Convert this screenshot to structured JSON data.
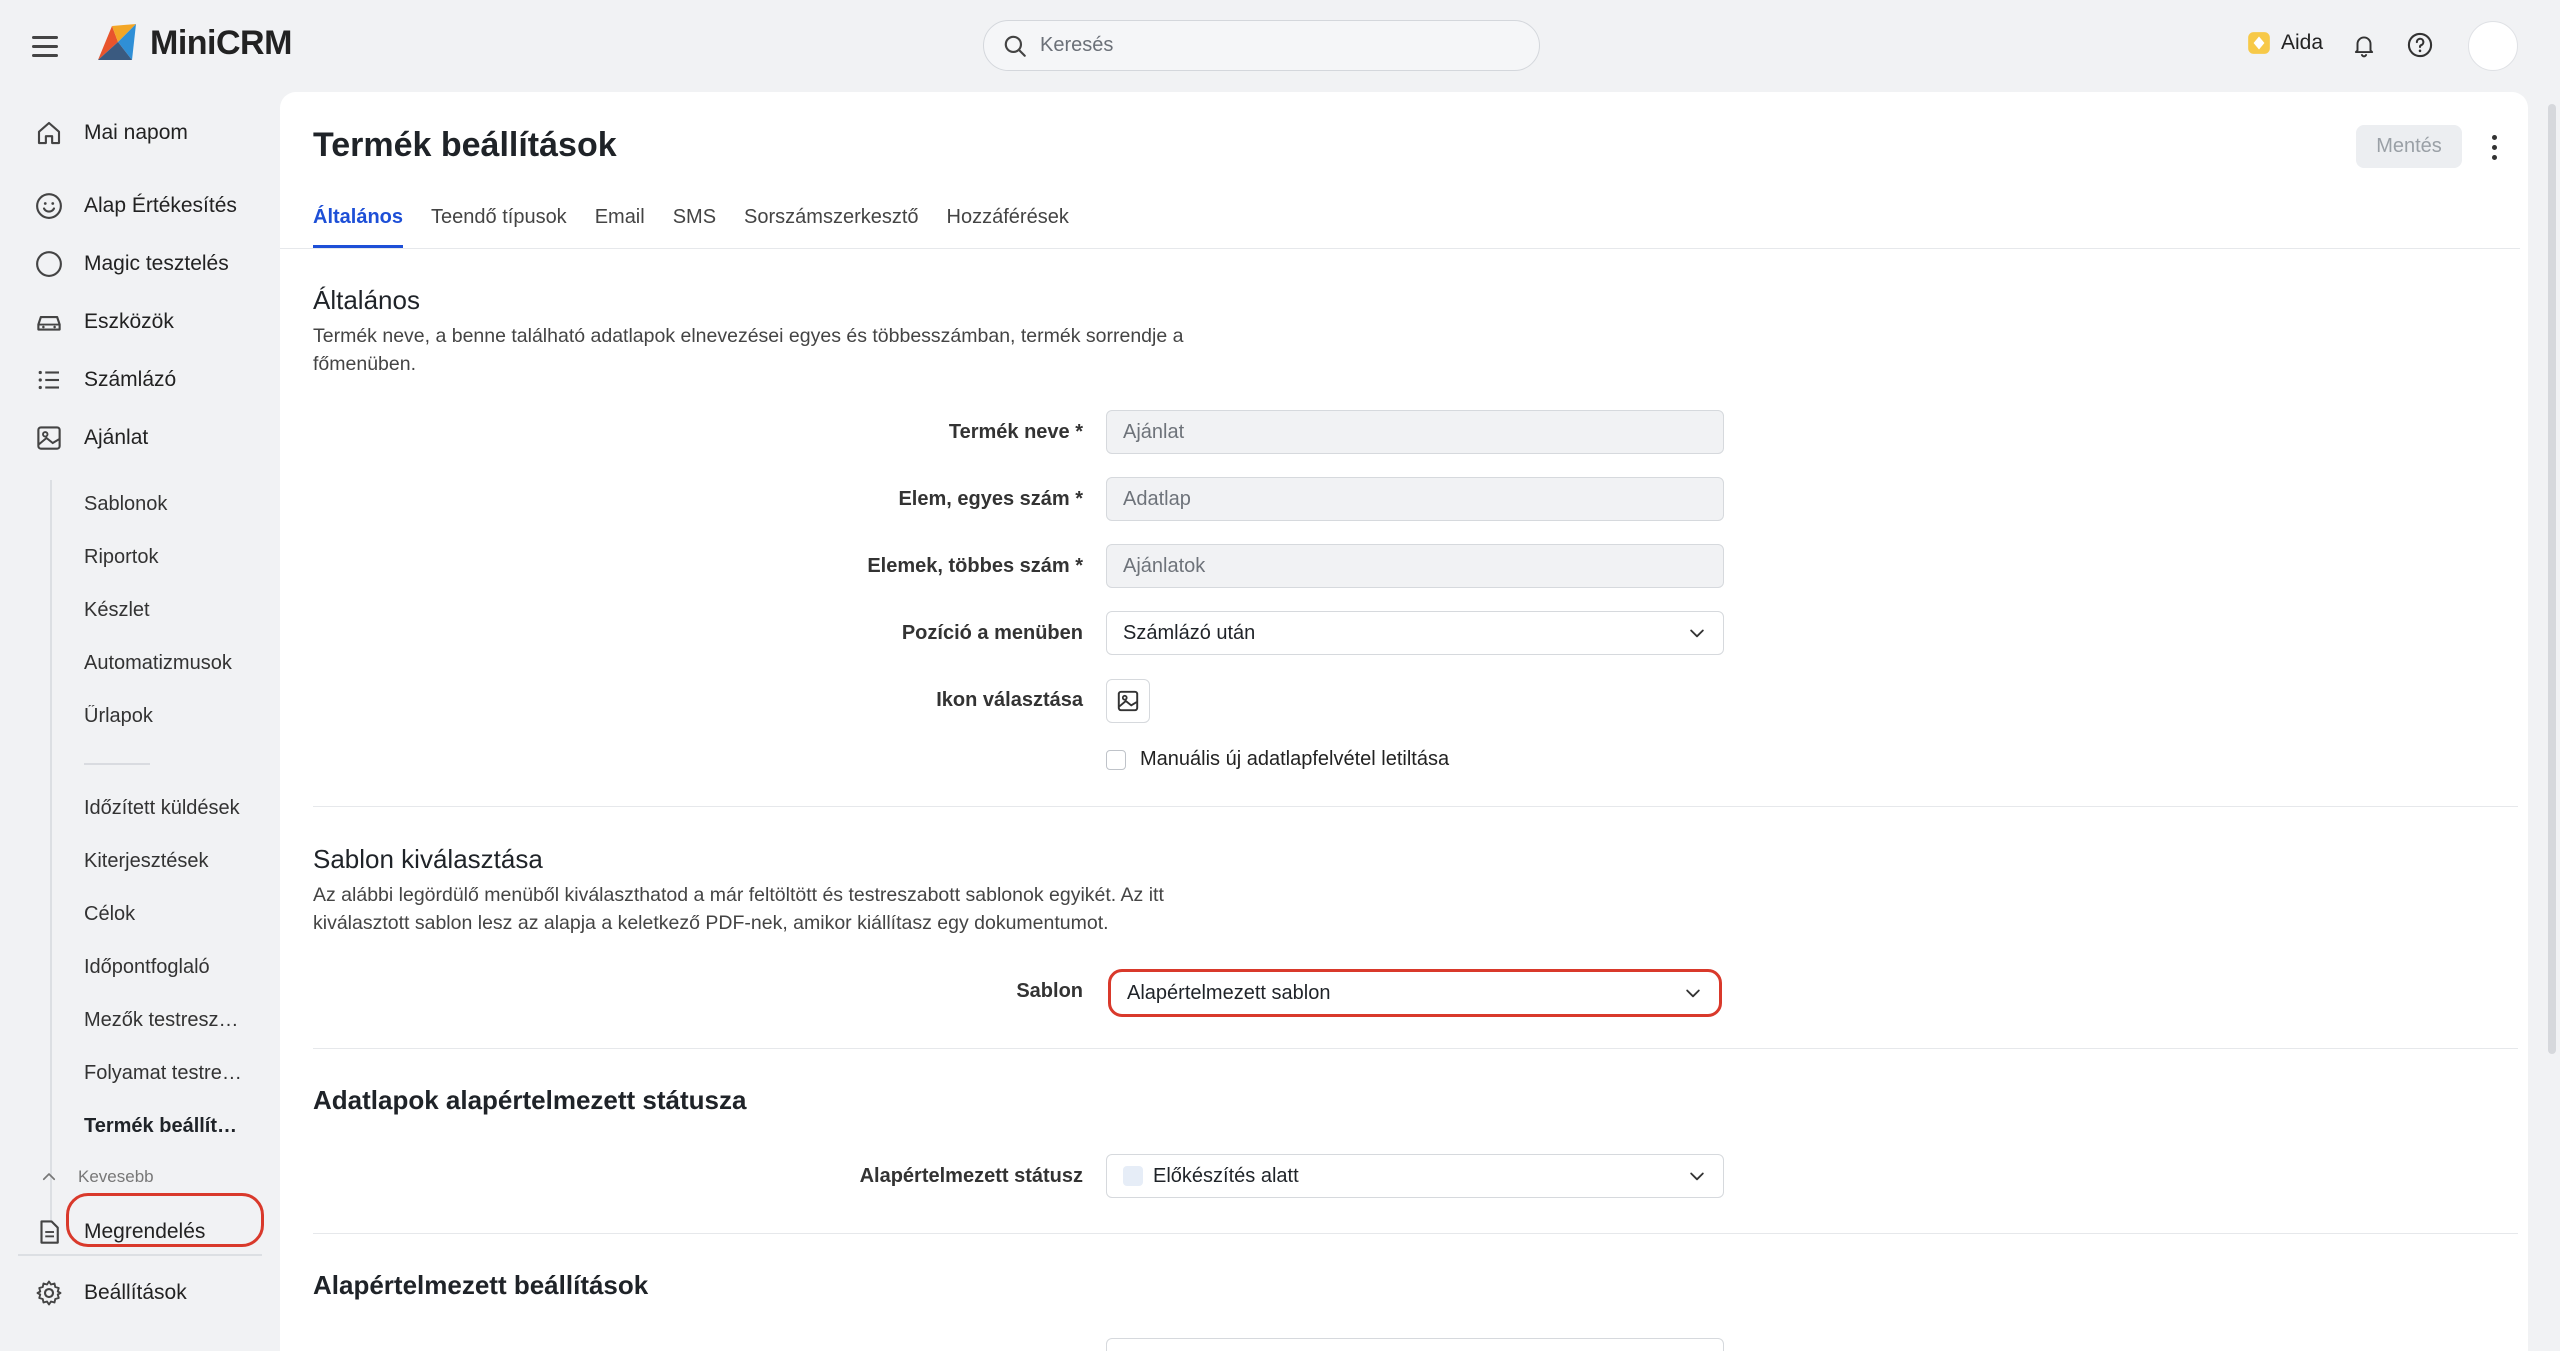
{
  "app": {
    "name": "MiniCRM"
  },
  "search": {
    "placeholder": "Keresés"
  },
  "header": {
    "ai_label": "Aida"
  },
  "sidebar": {
    "main_items": [
      {
        "label": "Mai napom",
        "icon": "home-icon"
      },
      {
        "label": "Alap Értékesítés",
        "icon": "smiley-icon"
      },
      {
        "label": "Magic tesztelés",
        "icon": "circle-icon"
      },
      {
        "label": "Eszközök",
        "icon": "car-icon"
      },
      {
        "label": "Számlázó",
        "icon": "list-icon"
      },
      {
        "label": "Ajánlat",
        "icon": "image-icon"
      }
    ],
    "sub_items": [
      "Sablonok",
      "Riportok",
      "Készlet",
      "Automatizmusok",
      "Űrlapok",
      "Időzített küldések",
      "Kiterjesztések",
      "Célok",
      "Időpontfoglaló",
      "Mezők testreszabása",
      "Folyamat testreszabása",
      "Termék beállítások"
    ],
    "less_label": "Kevesebb",
    "bottom_items": [
      {
        "label": "Megrendelés",
        "icon": "document-icon"
      },
      {
        "label": "Beállítások",
        "icon": "gear-icon"
      }
    ]
  },
  "page": {
    "title": "Termék beállítások",
    "save_label": "Mentés",
    "tabs": [
      "Általános",
      "Teendő típusok",
      "Email",
      "SMS",
      "Sorszámszerkesztő",
      "Hozzáférések"
    ]
  },
  "general": {
    "title": "Általános",
    "desc_line1": "Termék neve, a benne található adatlapok elnevezései egyes és többesszámban, termék sorrendje a",
    "desc_line2": "főmenüben.",
    "fields": [
      {
        "label": "Termék neve *",
        "value": "Ajánlat"
      },
      {
        "label": "Elem, egyes szám *",
        "value": "Adatlap"
      },
      {
        "label": "Elemek, többes szám *",
        "value": "Ajánlatok"
      }
    ],
    "position_label": "Pozíció a menüben",
    "position_value": "Számlázó után",
    "icon_label": "Ikon választása",
    "checkbox_label": "Manuális új adatlapfelvétel letiltása"
  },
  "template": {
    "title": "Sablon kiválasztása",
    "desc_line1": "Az alábbi legördülő menüből kiválaszthatod a már feltöltött és testreszabott sablonok egyikét. Az itt",
    "desc_line2": "kiválasztott sablon lesz az alapja a keletkező PDF-nek, amikor kiállítasz egy dokumentumot.",
    "label": "Sablon",
    "value": "Alapértelmezett sablon"
  },
  "status": {
    "title": "Adatlapok alapértelmezett státusza",
    "label": "Alapértelmezett státusz",
    "value": "Előkészítés alatt"
  },
  "defaults": {
    "title": "Alapértelmezett beállítások"
  },
  "colors": {
    "accent": "#1d4fd7",
    "highlight": "#d9392b"
  }
}
